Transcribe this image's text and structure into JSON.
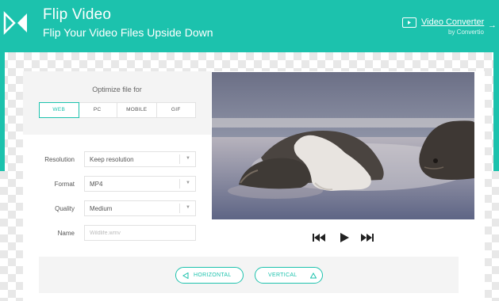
{
  "header": {
    "title": "Flip Video",
    "subtitle": "Flip Your Video Files Upside Down",
    "logo_icon": "flip-logo-icon",
    "link": {
      "title": "Video Converter",
      "sub": "by Convertio",
      "arrow": "→",
      "icon": "video-icon"
    }
  },
  "optimize": {
    "label": "Optimize file for",
    "options": [
      "WEB",
      "PC",
      "MOBILE",
      "GIF"
    ],
    "selected": "WEB"
  },
  "form": {
    "resolution": {
      "label": "Resolution",
      "value": "Keep resolution"
    },
    "format": {
      "label": "Format",
      "value": "MP4"
    },
    "quality": {
      "label": "Quality",
      "value": "Medium"
    },
    "name": {
      "label": "Name",
      "placeholder": "Wildlife.wmv"
    }
  },
  "player": {
    "prev_icon": "skip-back-icon",
    "play_icon": "play-icon",
    "next_icon": "skip-forward-icon"
  },
  "flip": {
    "horizontal_label": "HORIZONTAL",
    "vertical_label": "VERTICAL"
  },
  "colors": {
    "accent": "#1cc2ad",
    "panel": "#f4f4f4"
  }
}
